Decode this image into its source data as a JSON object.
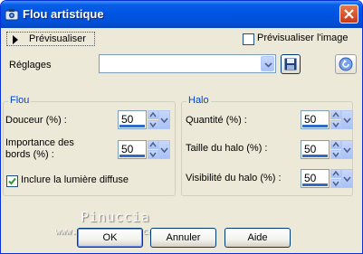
{
  "window": {
    "title": "Flou artistique",
    "title_icon": "app-camera-icon",
    "close_icon": "close-icon"
  },
  "toolbar": {
    "preview_button_label": "Prévisualiser",
    "preview_image_label": "Prévisualiser l'image",
    "preview_image_checked": false
  },
  "settings": {
    "label": "Réglages",
    "value": "",
    "save_icon": "floppy-disk-icon",
    "reset_icon": "reset-arrow-icon"
  },
  "flou": {
    "title": "Flou",
    "douceur_label": "Douceur (%) :",
    "douceur_value": "50",
    "importance_label_line1": "Importance des",
    "importance_label_line2": "bords (%) :",
    "importance_value": "50",
    "diffuse_label": "Inclure la lumière diffuse",
    "diffuse_checked": true
  },
  "halo": {
    "title": "Halo",
    "quantite_label": "Quantité (%) :",
    "quantite_value": "50",
    "taille_label": "Taille du halo (%) :",
    "taille_value": "50",
    "visibilite_label": "Visibilité du halo (%) :",
    "visibilite_value": "50"
  },
  "buttons": {
    "ok": "OK",
    "cancel": "Annuler",
    "help": "Aide"
  },
  "watermark": {
    "name": "Pinuccia",
    "url": "www.maidireqrafica.eu"
  },
  "colors": {
    "titlebar": "#0054e3",
    "group_title": "#0046d5",
    "dialog_bg": "#ece9d8"
  }
}
